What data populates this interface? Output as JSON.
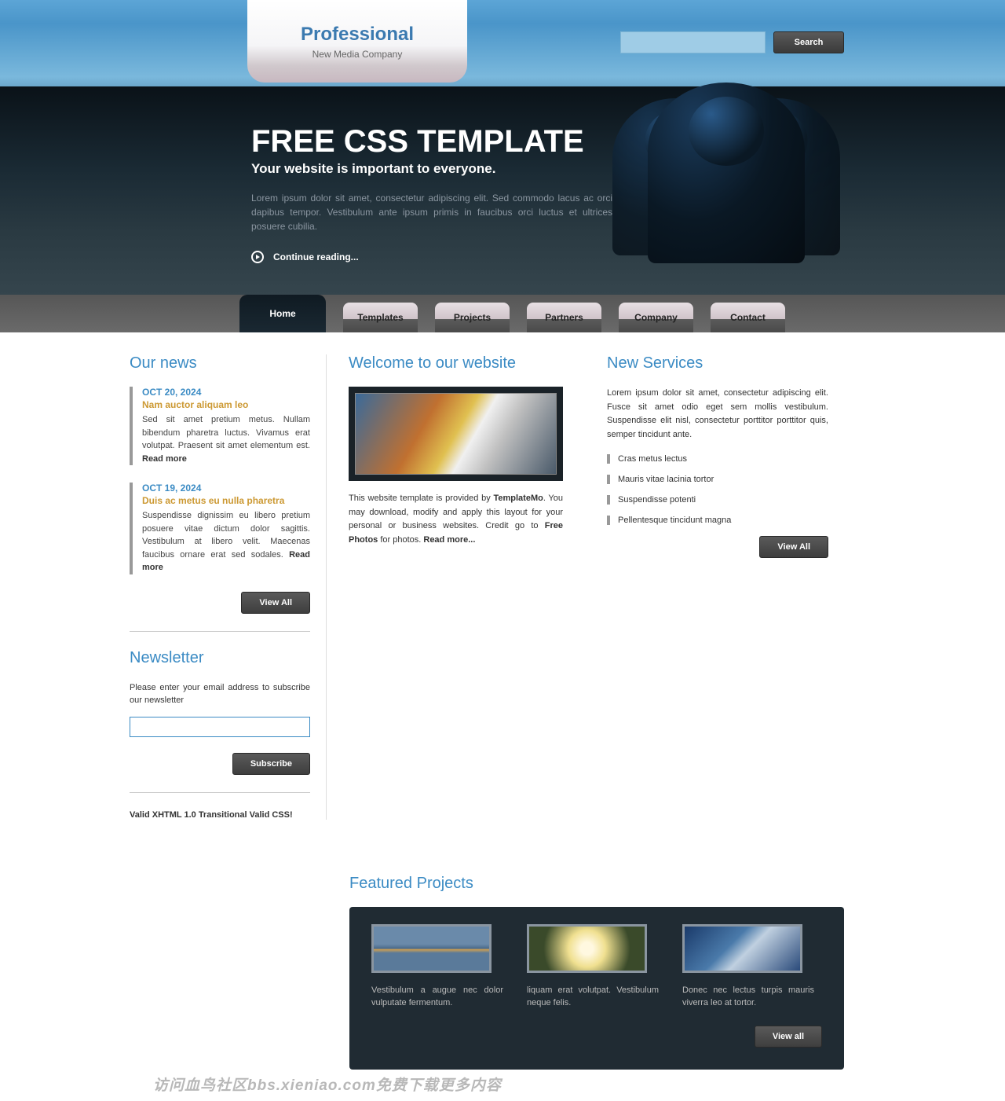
{
  "logo": {
    "title": "Professional",
    "subtitle": "New Media Company"
  },
  "search": {
    "button": "Search",
    "value": ""
  },
  "hero": {
    "title": "FREE CSS TEMPLATE",
    "subtitle": "Your website is important to everyone.",
    "body": "Lorem ipsum dolor sit amet, consectetur adipiscing elit. Sed commodo lacus ac orci dapibus tempor. Vestibulum ante ipsum primis in faucibus orci luctus et ultrices posuere cubilia.",
    "continue": "Continue reading..."
  },
  "nav": [
    {
      "label": "Home",
      "active": true
    },
    {
      "label": "Templates",
      "active": false
    },
    {
      "label": "Projects",
      "active": false
    },
    {
      "label": "Partners",
      "active": false
    },
    {
      "label": "Company",
      "active": false
    },
    {
      "label": "Contact",
      "active": false
    }
  ],
  "news": {
    "heading": "Our news",
    "items": [
      {
        "date": "OCT 20, 2024",
        "title": "Nam auctor aliquam leo",
        "body": "Sed sit amet pretium metus. Nullam bibendum pharetra luctus. Vivamus erat volutpat. Praesent sit amet elementum est. ",
        "read": "Read more"
      },
      {
        "date": "OCT 19, 2024",
        "title": "Duis ac metus eu nulla pharetra",
        "body": "Suspendisse dignissim eu libero pretium posuere vitae dictum dolor sagittis. Vestibulum at libero velit. Maecenas faucibus ornare erat sed sodales. ",
        "read": "Read more"
      }
    ],
    "view_all": "View All"
  },
  "newsletter": {
    "heading": "Newsletter",
    "text": "Please enter your email address to subscribe our newsletter",
    "placeholder": "",
    "subscribe": "Subscribe"
  },
  "valid": "Valid XHTML 1.0 Transitional Valid CSS!",
  "welcome": {
    "heading": "Welcome to our website",
    "body_pre": "This website template is provided by ",
    "providerlink": "TemplateMo",
    "body_mid": ". You may download, modify and apply this layout for your personal or business websites. Credit go to ",
    "photoslink": "Free Photos",
    "body_end": " for photos. ",
    "read_more": "Read more..."
  },
  "services": {
    "heading": "New Services",
    "body": "Lorem ipsum dolor sit amet, consectetur adipiscing elit. Fusce sit amet odio eget sem mollis vestibulum. Suspendisse elit nisl, consectetur porttitor porttitor quis, semper tincidunt ante.",
    "items": [
      "Cras metus lectus",
      "Mauris vitae lacinia tortor",
      "Suspendisse potenti",
      "Pellentesque tincidunt magna"
    ],
    "view_all": "View All"
  },
  "featured": {
    "heading": "Featured Projects",
    "items": [
      "Vestibulum a augue nec dolor vulputate fermentum.",
      "liquam erat volutpat. Vestibulum neque felis.",
      "Donec nec lectus turpis mauris viverra leo at tortor."
    ],
    "view_all": "View all"
  },
  "watermark": "访问血鸟社区bbs.xieniao.com免费下载更多内容"
}
